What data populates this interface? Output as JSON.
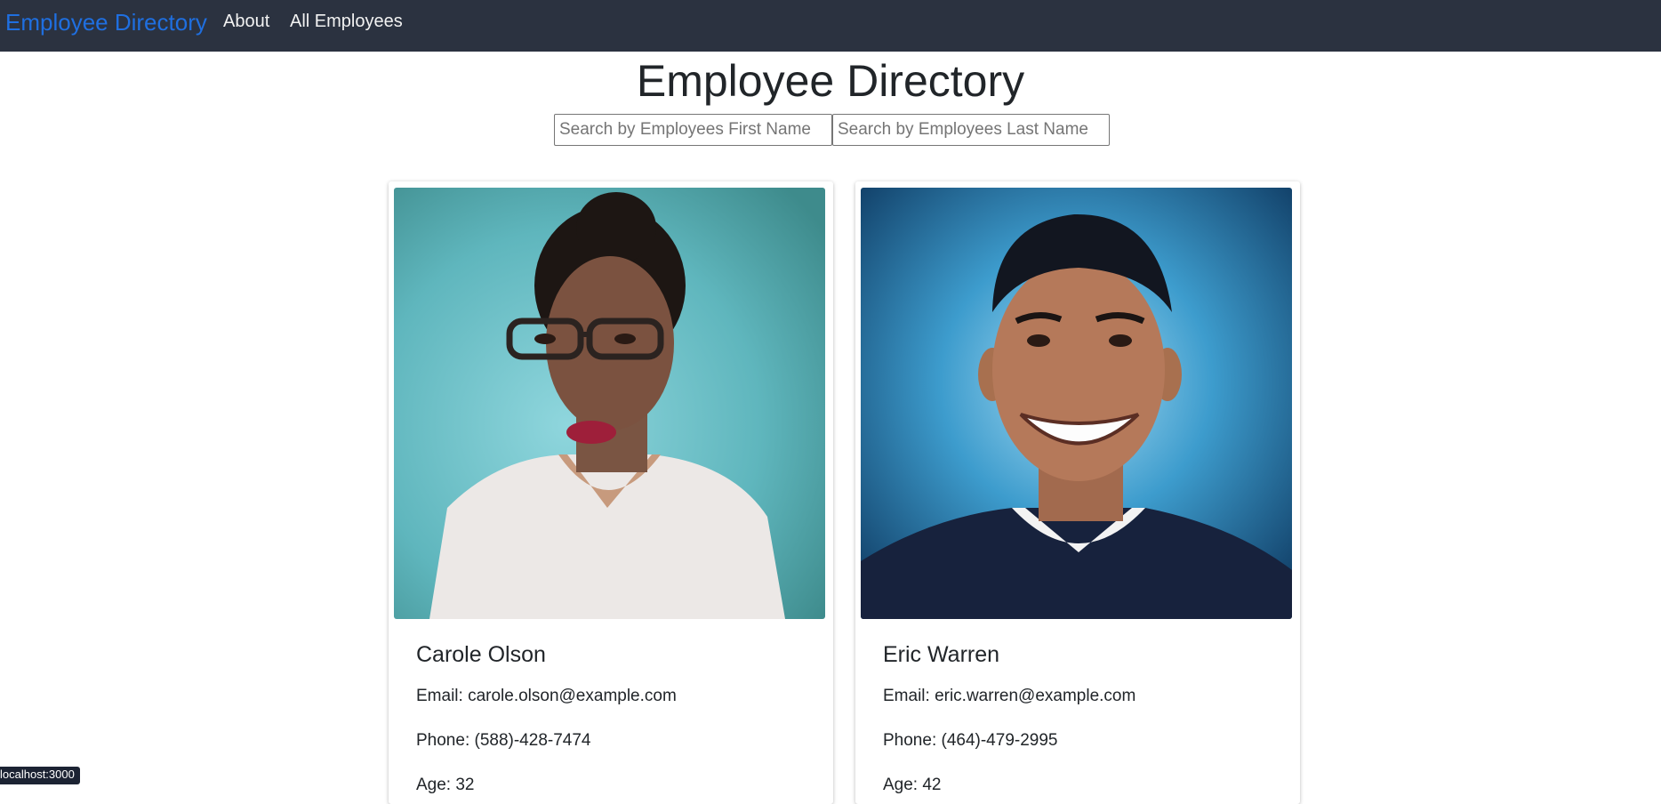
{
  "navbar": {
    "brand": "Employee Directory",
    "links": [
      "About",
      "All Employees"
    ]
  },
  "main": {
    "title": "Employee Directory",
    "search_first_placeholder": "Search by Employees First Name",
    "search_last_placeholder": "Search by Employees Last Name"
  },
  "employees": [
    {
      "name": "Carole Olson",
      "email": "Email: carole.olson@example.com",
      "phone": "Phone: (588)-428-7474",
      "age": "Age: 32"
    },
    {
      "name": "Eric Warren",
      "email": "Email: eric.warren@example.com",
      "phone": "Phone: (464)-479-2995",
      "age": "Age: 42"
    }
  ],
  "status_tooltip": "localhost:3000",
  "colors": {
    "navbar_bg": "#2b3240",
    "brand": "#1f6fe0",
    "nav_link": "#f2f2f2"
  }
}
